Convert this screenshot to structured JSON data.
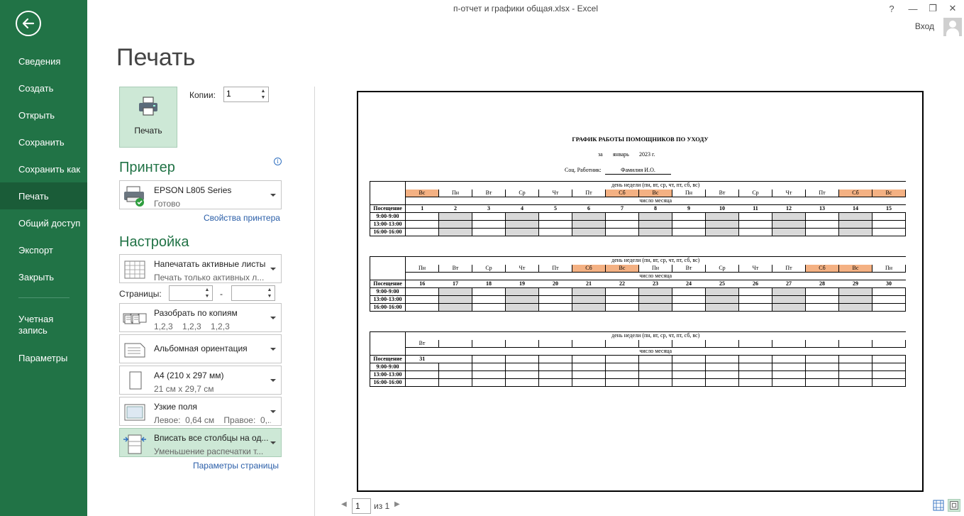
{
  "window": {
    "title": "п-отчет и графики общая.xlsx - Excel",
    "help": "?",
    "minimize": "—",
    "restore": "❐",
    "close": "✕",
    "signin": "Вход"
  },
  "sidebar": {
    "items": [
      {
        "label": "Сведения"
      },
      {
        "label": "Создать"
      },
      {
        "label": "Открыть"
      },
      {
        "label": "Сохранить"
      },
      {
        "label": "Сохранить как"
      },
      {
        "label": "Печать"
      },
      {
        "label": "Общий доступ"
      },
      {
        "label": "Экспорт"
      },
      {
        "label": "Закрыть"
      },
      {
        "label": "Учетная запись",
        "line1": "Учетная",
        "line2": "запись"
      },
      {
        "label": "Параметры"
      }
    ]
  },
  "print": {
    "heading": "Печать",
    "button_label": "Печать",
    "copies_label": "Копии:",
    "copies_value": "1"
  },
  "printer": {
    "heading": "Принтер",
    "name": "EPSON L805 Series",
    "status": "Готово",
    "properties_link": "Свойства принтера"
  },
  "settings": {
    "heading": "Настройка",
    "scope": {
      "title": "Напечатать активные листы",
      "sub": "Печать только активных л..."
    },
    "pages_label": "Страницы:",
    "pages_dash": "-",
    "collate": {
      "title": "Разобрать по копиям",
      "sub": "1,2,3    1,2,3    1,2,3"
    },
    "orientation": {
      "title": "Альбомная ориентация"
    },
    "paper": {
      "title": "A4 (210 x 297 мм)",
      "sub": "21 см x 29,7 см"
    },
    "margins": {
      "title": "Узкие поля",
      "sub": "Левое:  0,64 см    Правое:  0,..."
    },
    "scaling": {
      "title": "Вписать все столбцы на од...",
      "sub": "Уменьшение распечатки т..."
    },
    "page_setup_link": "Параметры страницы"
  },
  "preview": {
    "title": "ГРАФИК РАБОТЫ ПОМОЩНИКОВ ПО УХОДУ",
    "for_label": "за",
    "month": "январь",
    "year": "2023 г.",
    "worker_label": "Соц. Работник:",
    "worker_name": "Фамилия И.О.",
    "weekday_header": "день недели (пн, вт, ср, чт, пт, сб, вс)",
    "daynum_header": "число месяца",
    "visit_label": "Посещение",
    "slots": [
      "9:00-9:00",
      "13:00-13:00",
      "16:00-16:00"
    ],
    "blocks": [
      {
        "weekdays": [
          "Вс",
          "Пн",
          "Вт",
          "Ср",
          "Чт",
          "Пт",
          "Сб",
          "Вс",
          "Пн",
          "Вт",
          "Ср",
          "Чт",
          "Пт",
          "Сб",
          "Вс"
        ],
        "days": [
          "1",
          "2",
          "3",
          "4",
          "5",
          "6",
          "7",
          "8",
          "9",
          "10",
          "11",
          "12",
          "13",
          "14",
          "15"
        ],
        "weekend": [
          0,
          6,
          7,
          13,
          14
        ],
        "gray": [
          1,
          3,
          5,
          7,
          9,
          11,
          13
        ]
      },
      {
        "weekdays": [
          "Пн",
          "Вт",
          "Ср",
          "Чт",
          "Пт",
          "Сб",
          "Вс",
          "Пн",
          "Вт",
          "Ср",
          "Чт",
          "Пт",
          "Сб",
          "Вс",
          "Пн"
        ],
        "days": [
          "16",
          "17",
          "18",
          "19",
          "20",
          "21",
          "22",
          "23",
          "24",
          "25",
          "26",
          "27",
          "28",
          "29",
          "30"
        ],
        "weekend": [
          5,
          6,
          12,
          13
        ],
        "gray": [
          1,
          3,
          5,
          7,
          9,
          11,
          13
        ]
      },
      {
        "weekdays": [
          "Вт",
          "",
          "",
          "",
          "",
          "",
          "",
          "",
          "",
          "",
          "",
          "",
          "",
          "",
          ""
        ],
        "days": [
          "31",
          "",
          "",
          "",
          "",
          "",
          "",
          "",
          "",
          "",
          "",
          "",
          "",
          "",
          ""
        ],
        "weekend": [],
        "gray": []
      }
    ]
  },
  "pager": {
    "current": "1",
    "of_label": "из 1"
  }
}
